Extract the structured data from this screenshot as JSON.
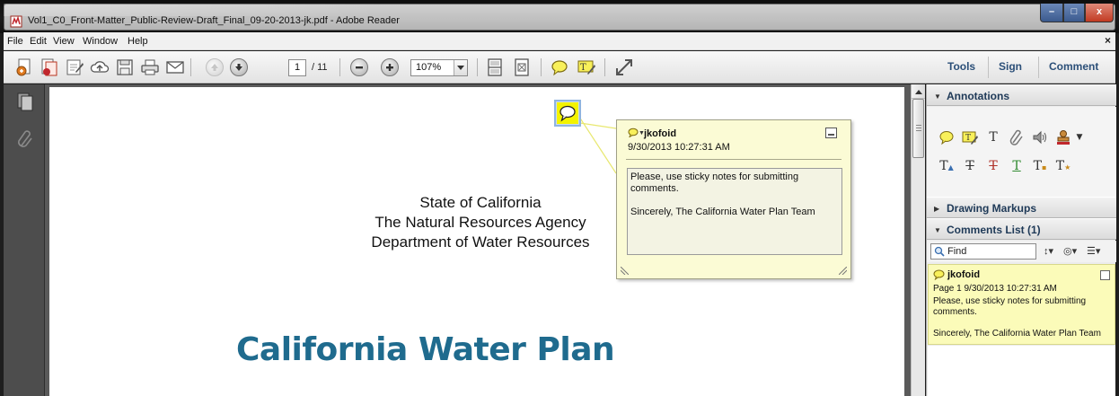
{
  "window": {
    "title": "Vol1_C0_Front-Matter_Public-Review-Draft_Final_09-20-2013-jk.pdf - Adobe Reader",
    "minimize_glyph": "–",
    "maximize_glyph": "□",
    "close_glyph": "x"
  },
  "menu": {
    "items": [
      "File",
      "Edit",
      "View",
      "Window",
      "Help"
    ],
    "close_doc_glyph": "×"
  },
  "toolbar": {
    "page_current": "1",
    "page_total": "/ 11",
    "zoom": "107%",
    "tabs": [
      "Tools",
      "Sign",
      "Comment"
    ]
  },
  "document": {
    "agency_lines": [
      "State of California",
      "The Natural Resources Agency",
      "Department of Water Resources"
    ],
    "heading": "California Water Plan"
  },
  "note_popup": {
    "author": "jkofoid",
    "date": "9/30/2013 10:27:31 AM",
    "body": "Please, use sticky notes for submitting comments.\n\nSincerely, The California Water Plan Team"
  },
  "right_pane": {
    "sections": {
      "annotations": "Annotations",
      "drawing_markups": "Drawing Markups",
      "comments_list": "Comments List (1)"
    },
    "find_placeholder": "Find",
    "comment": {
      "author": "jkofoid",
      "meta": "Page 1  9/30/2013 10:27:31 AM",
      "text": "Please, use sticky notes for submitting comments.\n\nSincerely, The California Water Plan Team"
    }
  },
  "colors": {
    "heading": "#1f6b8e",
    "tab_text": "#2b4f78",
    "sticky_yellow": "#f3f300",
    "popup_bg": "#fbfbd5",
    "comment_bg": "#fbfbb9"
  }
}
